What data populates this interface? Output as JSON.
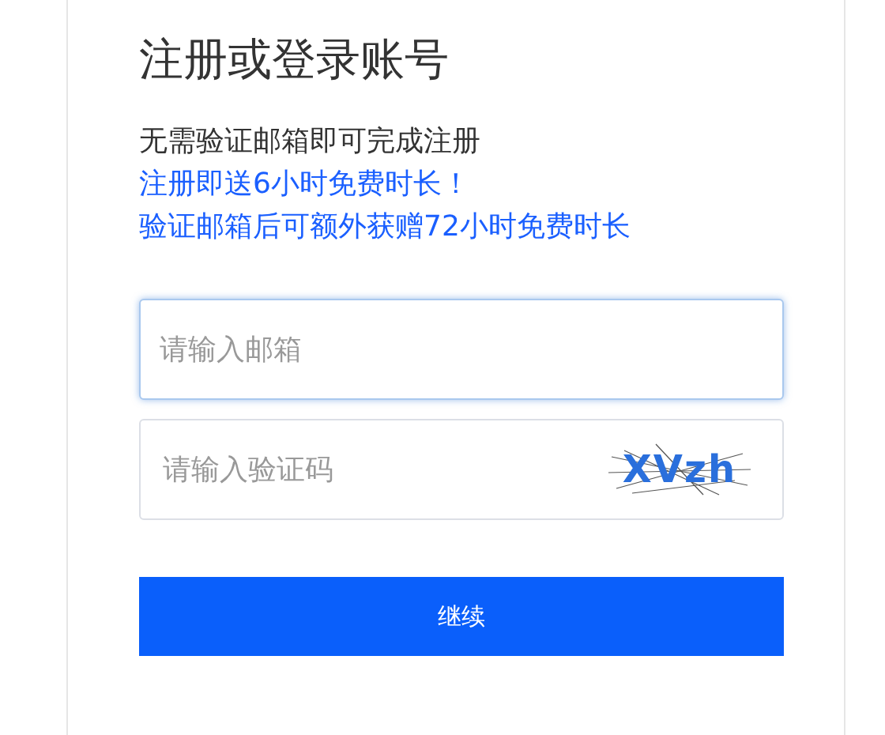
{
  "title": "注册或登录账号",
  "notes": [
    {
      "text": "无需验证邮箱即可完成注册",
      "kind": "plain"
    },
    {
      "text": "注册即送6小时免费时长！",
      "kind": "promo"
    },
    {
      "text": "验证邮箱后可额外获赠72小时免费时长",
      "kind": "promo"
    }
  ],
  "email_field": {
    "placeholder": "请输入邮箱",
    "focused": true
  },
  "code_field": {
    "placeholder": "请输入验证码"
  },
  "captcha": {
    "text": "XVzh"
  },
  "continue_button": {
    "label": "继续"
  }
}
